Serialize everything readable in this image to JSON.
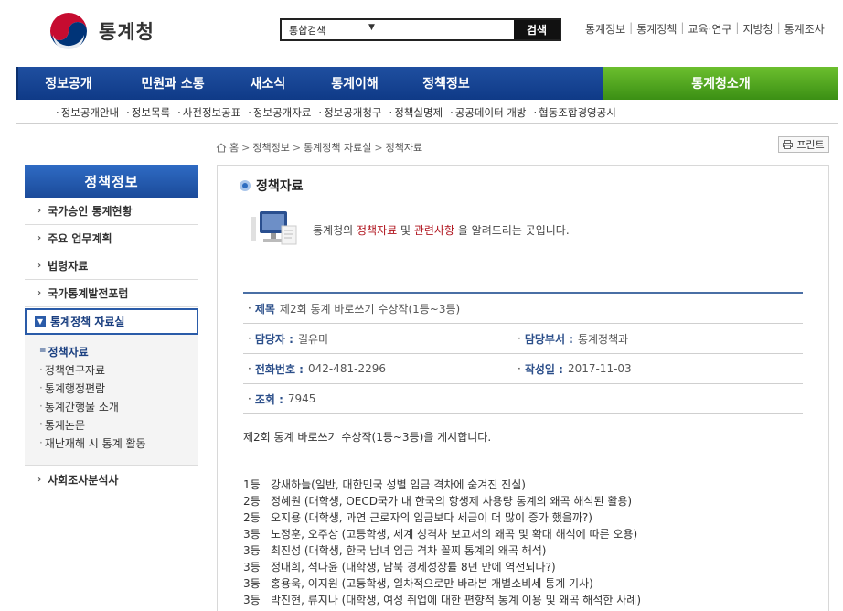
{
  "header": {
    "logo_text": "통계청",
    "search_scope": "통합검색",
    "search_value": "",
    "search_button": "검색",
    "top_links": [
      "통계정보",
      "통계정책",
      "교육·연구",
      "지방청",
      "통계조사"
    ]
  },
  "main_nav": {
    "items": [
      "정보공개",
      "민원과 소통",
      "새소식",
      "통계이해",
      "정책정보"
    ],
    "right_item": "통계청소개",
    "colors": {
      "nav_blue": "#1f4fa0",
      "nav_green": "#4aa01c"
    }
  },
  "sub_nav": {
    "items": [
      "정보공개안내",
      "정보목록",
      "사전정보공표",
      "정보공개자료",
      "정보공개청구",
      "정책실명제",
      "공공데이터 개방",
      "협동조합경영공시"
    ]
  },
  "breadcrumb": {
    "items": [
      "홈",
      "정책정보",
      "통계정책 자료실",
      "정책자료"
    ],
    "print_label": "프린트"
  },
  "sidebar": {
    "title": "정책정보",
    "items": [
      {
        "label": "국가승인 통계현황"
      },
      {
        "label": "주요 업무계획"
      },
      {
        "label": "법령자료"
      },
      {
        "label": "국가통계발전포럼"
      }
    ],
    "active_item": "통계정책 자료실",
    "sub_items": [
      {
        "label": "정책자료",
        "current": true
      },
      {
        "label": "정책연구자료",
        "current": false
      },
      {
        "label": "통계행정편람",
        "current": false
      },
      {
        "label": "통계간행물 소개",
        "current": false
      },
      {
        "label": "통계논문",
        "current": false
      },
      {
        "label": "재난재해 시 통계 활동",
        "current": false
      }
    ],
    "last_item": "사회조사분석사"
  },
  "content": {
    "title": "정책자료",
    "intro_prefix": "통계청의 ",
    "intro_red1": "정책자료",
    "intro_mid": " 및 ",
    "intro_red2": "관련사항",
    "intro_suffix": " 을 알려드리는 곳입니다.",
    "info": {
      "subject_label": "제목",
      "subject_value": "제2회 통계 바로쓰기 수상작(1등~3등)",
      "manager_label": "담당자 :",
      "manager_value": "길유미",
      "dept_label": "담당부서 :",
      "dept_value": "통계정책과",
      "phone_label": "전화번호 :",
      "phone_value": "042-481-2296",
      "date_label": "작성일 :",
      "date_value": "2017-11-03",
      "views_label": "조회 :",
      "views_value": "7945"
    },
    "body": "제2회 통계 바로쓰기 수상작(1등~3등)을 게시합니다.",
    "awards": [
      {
        "rank": "1등",
        "text": "강새하늘(일반, 대한민국 성별 임금 격차에 숨겨진 진실)"
      },
      {
        "rank": "2등",
        "text": "정혜원  (대학생, OECD국가 내 한국의 항생제 사용량 통계의 왜곡 해석된 활용)"
      },
      {
        "rank": "2등",
        "text": "오지용  (대학생, 과연 근로자의 임금보다 세금이 더 많이 증가 했을까?)"
      },
      {
        "rank": "3등",
        "text": "노정훈, 오주상 (고등학생, 세계 성격차 보고서의 왜곡 및 확대 해석에 따른 오용)"
      },
      {
        "rank": "3등",
        "text": "최진성  (대학생, 한국 남녀 임금 격차 꼴찌 통계의 왜곡 해석)"
      },
      {
        "rank": "3등",
        "text": "정대희, 석다윤 (대학생,  남북 경제성장률 8년 만에 역전되나?)"
      },
      {
        "rank": "3등",
        "text": "홍용욱, 이지원 (고등학생, 일차적으로만 바라본 개별소비세 통계 기사)"
      },
      {
        "rank": "3등",
        "text": "박진현, 류지나 (대학생,   여성 취업에 대한 편향적 통계 이용 및 왜곡 해석한 사례)"
      }
    ]
  }
}
